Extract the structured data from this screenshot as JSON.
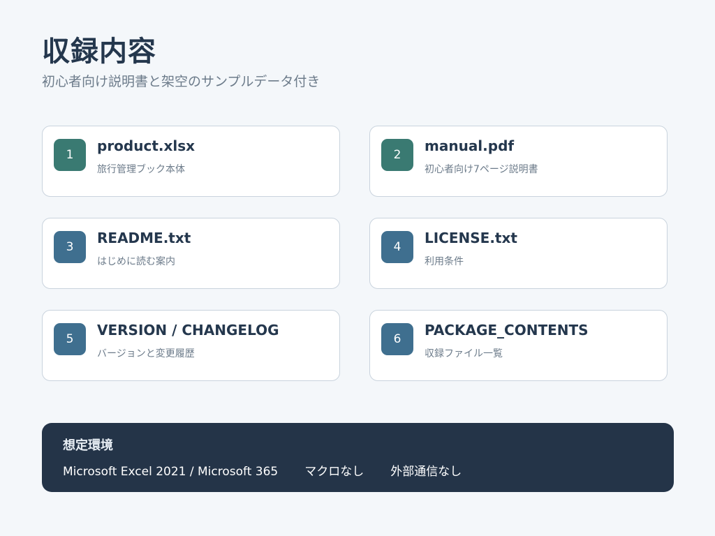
{
  "header": {
    "title": "収録内容",
    "subtitle": "初心者向け説明書と架空のサンプルデータ付き"
  },
  "files": [
    {
      "number": "1",
      "name": "product.xlsx",
      "description": "旅行管理ブック本体"
    },
    {
      "number": "2",
      "name": "manual.pdf",
      "description": "初心者向け7ページ説明書"
    },
    {
      "number": "3",
      "name": "README.txt",
      "description": "はじめに読む案内"
    },
    {
      "number": "4",
      "name": "LICENSE.txt",
      "description": "利用条件"
    },
    {
      "number": "5",
      "name": "VERSION / CHANGELOG",
      "description": "バージョンと変更履歴"
    },
    {
      "number": "6",
      "name": "PACKAGE_CONTENTS",
      "description": "収録ファイル一覧"
    }
  ],
  "environment": {
    "title": "想定環境",
    "items": [
      "Microsoft Excel 2021 / Microsoft 365",
      "マクロなし",
      "外部通信なし"
    ]
  },
  "colors": {
    "background": "#f4f7fa",
    "text_dark": "#24374d",
    "text_muted": "#6c7b8a",
    "badge_teal": "#3a7a72",
    "badge_blue": "#3f6f8f",
    "panel": "#243448"
  }
}
